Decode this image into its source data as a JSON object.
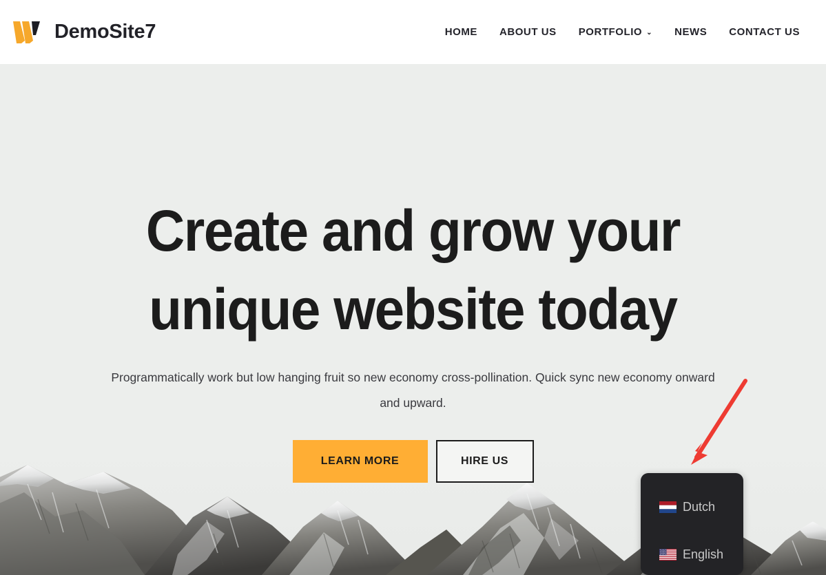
{
  "header": {
    "brand_name": "DemoSite7",
    "logo_icon": "w-logo-icon",
    "nav": [
      {
        "label": "HOME",
        "has_caret": false,
        "caret": ""
      },
      {
        "label": "ABOUT US",
        "has_caret": false,
        "caret": ""
      },
      {
        "label": "PORTFOLIO",
        "has_caret": true,
        "caret": "⌄"
      },
      {
        "label": "NEWS",
        "has_caret": false,
        "caret": ""
      },
      {
        "label": "CONTACT US",
        "has_caret": false,
        "caret": ""
      }
    ]
  },
  "hero": {
    "heading_line1": "Create and grow your",
    "heading_line2": "unique website today",
    "subtitle": "Programmatically work but low hanging fruit so new economy cross-pollination. Quick sync new economy onward and upward.",
    "primary_button": "LEARN MORE",
    "secondary_button": "HIRE US",
    "background_image": "snowy-mountain-range-photo"
  },
  "language_panel": {
    "items": [
      {
        "label": "Dutch",
        "flag": "netherlands-flag-icon"
      },
      {
        "label": "English",
        "flag": "usa-flag-icon"
      }
    ]
  },
  "annotation": {
    "type": "red-arrow",
    "points_to": "language-panel"
  },
  "colors": {
    "accent_orange": "#ffae34",
    "hero_background": "#eceeec",
    "header_background": "#ffffff",
    "panel_background": "#232326",
    "panel_text": "#c9c9c9",
    "heading_text": "#1c1c1c",
    "annotation_red": "#ee3b32"
  }
}
